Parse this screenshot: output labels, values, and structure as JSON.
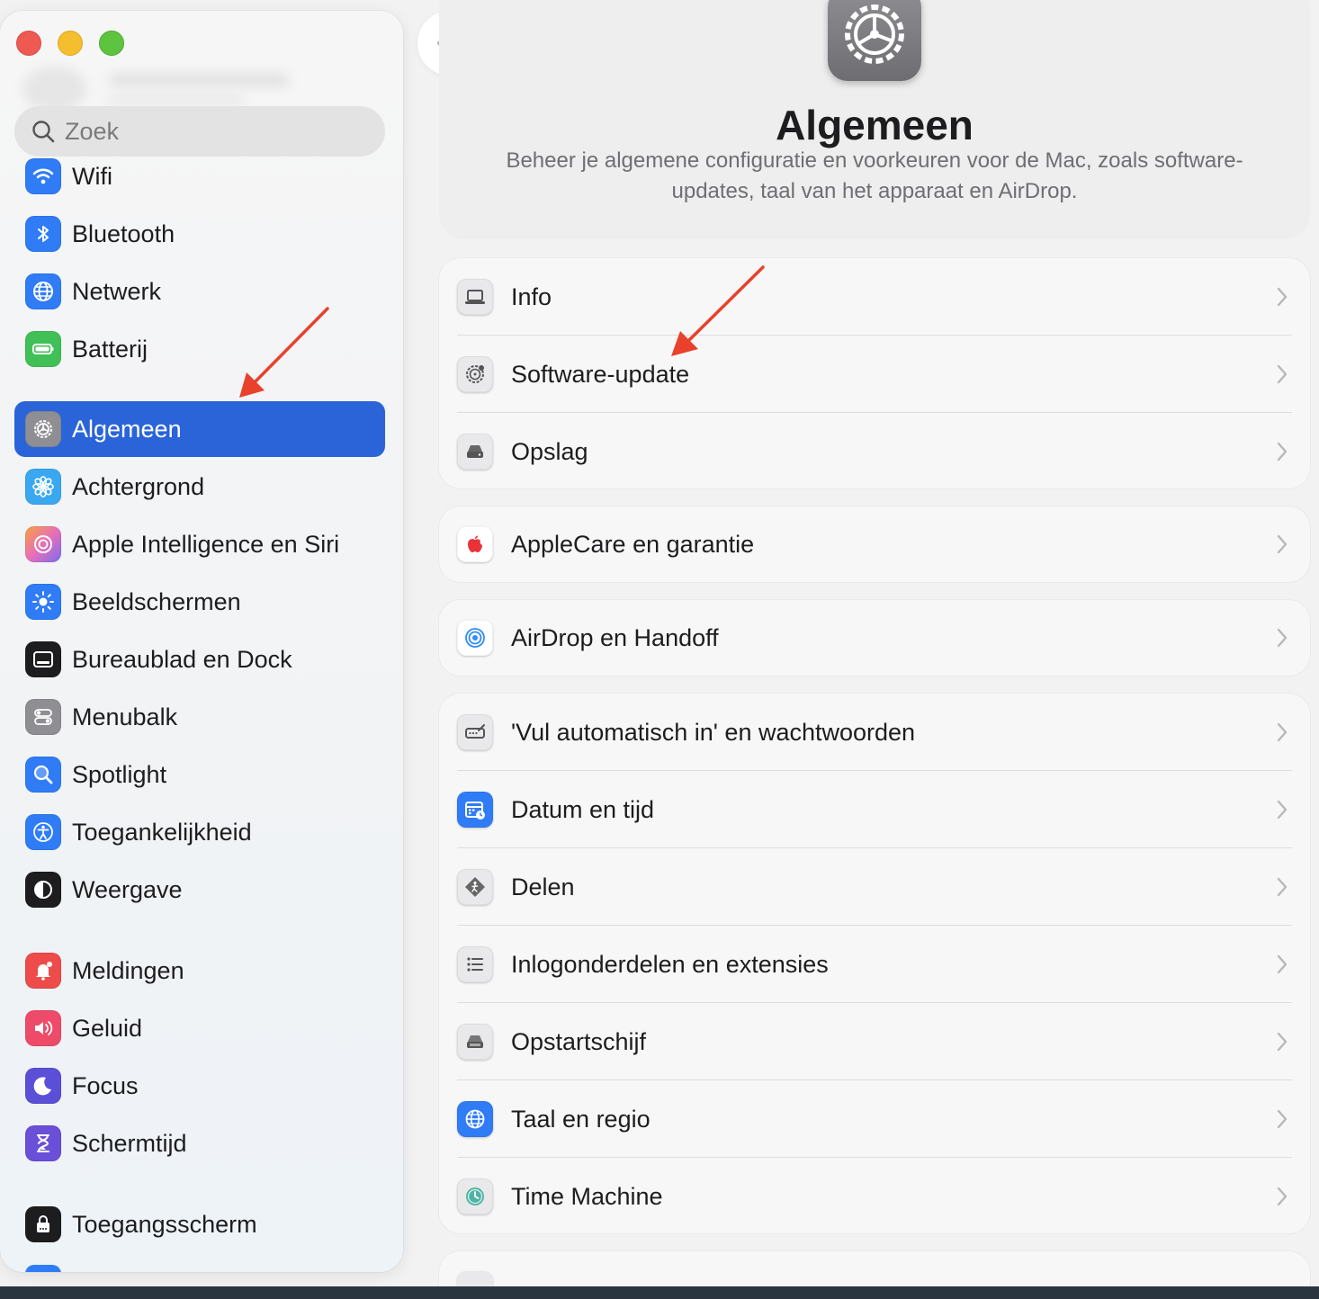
{
  "window": {
    "traffic_lights": [
      "close",
      "minimize",
      "zoom"
    ]
  },
  "sidebar": {
    "search_placeholder": "Zoek",
    "items": [
      {
        "label": "Wifi",
        "icon": "wifi-icon",
        "color": "#2f7cf6"
      },
      {
        "label": "Bluetooth",
        "icon": "bluetooth-icon",
        "color": "#2f7cf6"
      },
      {
        "label": "Netwerk",
        "icon": "globe-icon",
        "color": "#2f7cf6"
      },
      {
        "label": "Batterij",
        "icon": "battery-icon",
        "color": "#40c057"
      },
      {
        "label": "Algemeen",
        "icon": "gear-icon",
        "color": "#8e8e93",
        "selected": true
      },
      {
        "label": "Achtergrond",
        "icon": "flower-icon",
        "color": "#3aa8f0"
      },
      {
        "label": "Apple Intelligence en Siri",
        "icon": "siri-icon",
        "color": "#e86fb8"
      },
      {
        "label": "Beeldschermen",
        "icon": "sun-icon",
        "color": "#2f7cf6"
      },
      {
        "label": "Bureaublad en Dock",
        "icon": "dock-icon",
        "color": "#1d1d1f"
      },
      {
        "label": "Menubalk",
        "icon": "toggles-icon",
        "color": "#8e8e93"
      },
      {
        "label": "Spotlight",
        "icon": "magnifier-icon",
        "color": "#2f7cf6"
      },
      {
        "label": "Toegankelijkheid",
        "icon": "accessibility-icon",
        "color": "#2f7cf6"
      },
      {
        "label": "Weergave",
        "icon": "appearance-icon",
        "color": "#1d1d1f"
      },
      {
        "label": "Meldingen",
        "icon": "bell-icon",
        "color": "#ee4b4b"
      },
      {
        "label": "Geluid",
        "icon": "speaker-icon",
        "color": "#ee4b6a"
      },
      {
        "label": "Focus",
        "icon": "moon-icon",
        "color": "#5b4fd8"
      },
      {
        "label": "Schermtijd",
        "icon": "hourglass-icon",
        "color": "#6a4fd8"
      },
      {
        "label": "Toegangsscherm",
        "icon": "lock-icon",
        "color": "#1d1d1f"
      }
    ]
  },
  "nav": {
    "back": "chevron-left-icon",
    "forward": "chevron-right-icon"
  },
  "header": {
    "title": "Algemeen",
    "description": "Beheer je algemene configuratie en voorkeuren voor de Mac, zoals software-updates, taal van het apparaat en AirDrop."
  },
  "groups": [
    {
      "rows": [
        {
          "label": "Info",
          "icon": "laptop-icon"
        },
        {
          "label": "Software-update",
          "icon": "gear-badge-icon"
        },
        {
          "label": "Opslag",
          "icon": "drive-icon"
        }
      ]
    },
    {
      "rows": [
        {
          "label": "AppleCare en garantie",
          "icon": "apple-icon"
        }
      ]
    },
    {
      "rows": [
        {
          "label": "AirDrop en Handoff",
          "icon": "airdrop-icon"
        }
      ]
    },
    {
      "rows": [
        {
          "label": "'Vul automatisch in' en wachtwoorden",
          "icon": "autofill-icon"
        },
        {
          "label": "Datum en tijd",
          "icon": "calendar-clock-icon"
        },
        {
          "label": "Delen",
          "icon": "sharing-icon"
        },
        {
          "label": "Inlogonderdelen en extensies",
          "icon": "list-icon"
        },
        {
          "label": "Opstartschijf",
          "icon": "disk-icon"
        },
        {
          "label": "Taal en regio",
          "icon": "globe-icon"
        },
        {
          "label": "Time Machine",
          "icon": "time-machine-icon"
        }
      ]
    }
  ],
  "colors": {
    "accent": "#2a64d8",
    "annotation_arrow": "#e8412c"
  }
}
